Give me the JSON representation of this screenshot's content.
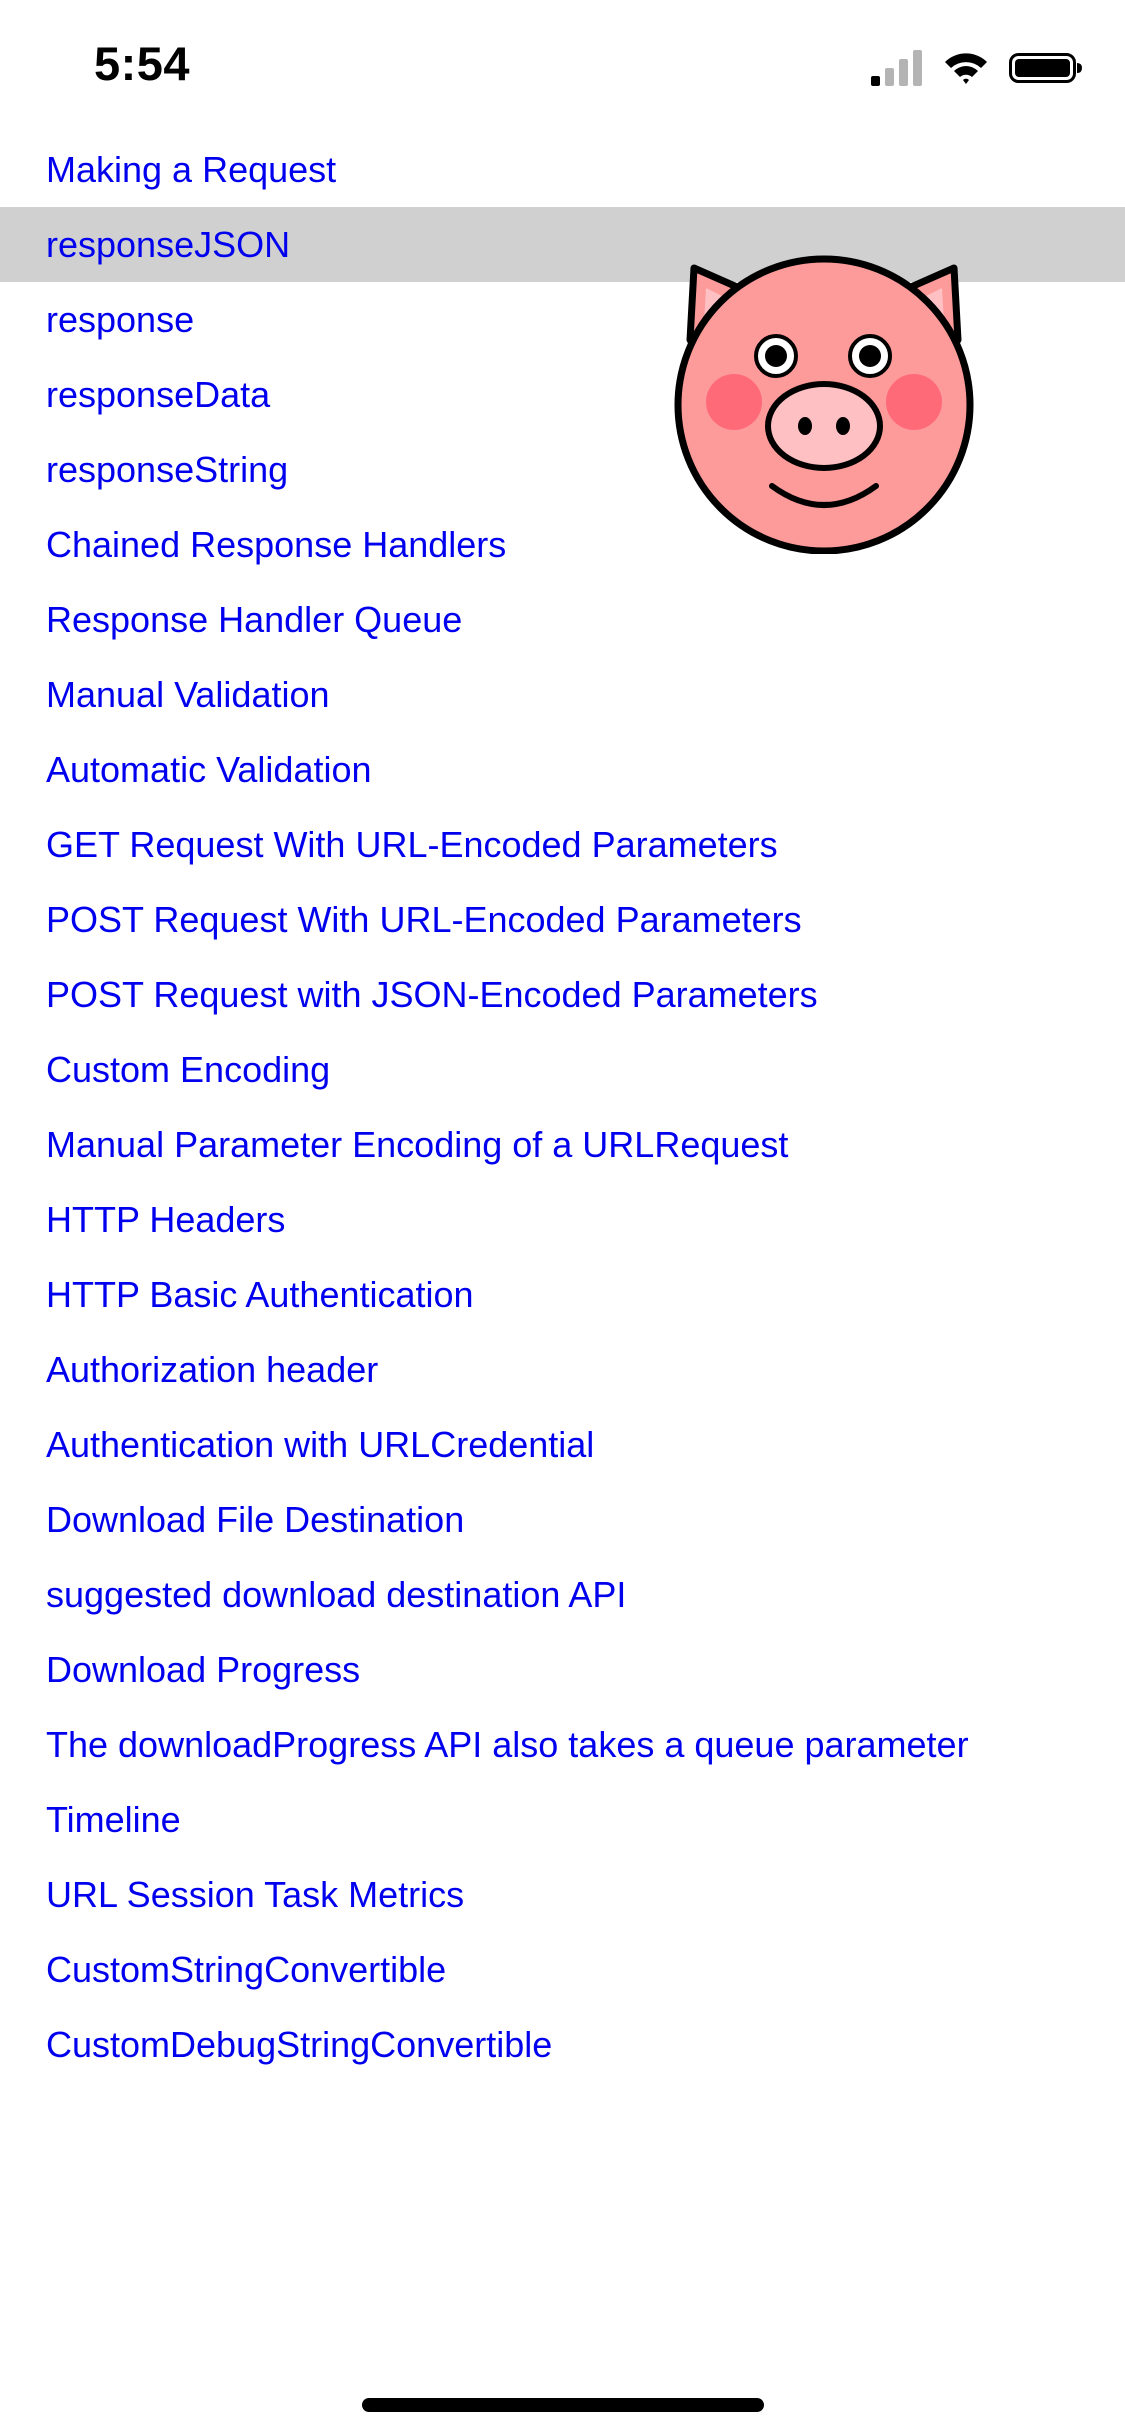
{
  "status_bar": {
    "time": "5:54",
    "icons": [
      "signal-icon",
      "wifi-icon",
      "battery-icon"
    ]
  },
  "menu": {
    "link_color": "#0000ee",
    "selected_color": "#d0d0d0",
    "selected_index": 1,
    "items": [
      {
        "label": "Making a Request"
      },
      {
        "label": "responseJSON"
      },
      {
        "label": "response"
      },
      {
        "label": "responseData"
      },
      {
        "label": "responseString"
      },
      {
        "label": "Chained Response Handlers"
      },
      {
        "label": "Response Handler Queue"
      },
      {
        "label": "Manual Validation"
      },
      {
        "label": "Automatic Validation"
      },
      {
        "label": "GET Request With URL-Encoded Parameters"
      },
      {
        "label": "POST Request With URL-Encoded Parameters"
      },
      {
        "label": "POST Request with JSON-Encoded Parameters"
      },
      {
        "label": "Custom Encoding"
      },
      {
        "label": "Manual Parameter Encoding of a URLRequest"
      },
      {
        "label": "HTTP Headers"
      },
      {
        "label": "HTTP Basic Authentication"
      },
      {
        "label": "Authorization header"
      },
      {
        "label": "Authentication with URLCredential"
      },
      {
        "label": "Download File Destination"
      },
      {
        "label": "suggested download destination API"
      },
      {
        "label": "Download Progress"
      },
      {
        "label": "The downloadProgress API also takes a queue parameter"
      },
      {
        "label": "Timeline"
      },
      {
        "label": "URL Session Task Metrics"
      },
      {
        "label": "CustomStringConvertible"
      },
      {
        "label": "CustomDebugStringConvertible"
      }
    ]
  },
  "overlay_image": {
    "icon": "pig-face-icon",
    "face_color": "#fd9a9a",
    "cheek_color": "#ff5a6e",
    "snout_color": "#ffc0c4"
  }
}
